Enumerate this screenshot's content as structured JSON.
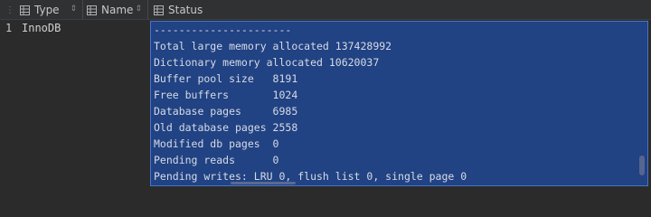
{
  "header": {
    "columns": [
      {
        "label": "Type"
      },
      {
        "label": "Name"
      },
      {
        "label": "Status"
      }
    ]
  },
  "row": {
    "number": "1",
    "type": "InnoDB",
    "status_lines": [
      "----------------------",
      "Total large memory allocated 137428992",
      "Dictionary memory allocated 10620037",
      "Buffer pool size   8191",
      "Free buffers       1024",
      "Database pages     6985",
      "Old database pages 2558",
      "Modified db pages  0",
      "Pending reads      0",
      "Pending writes: LRU 0, flush list 0, single page 0"
    ]
  },
  "colors": {
    "selection": "#214283",
    "selection_border": "#4a74c9",
    "background": "#2b2b2b"
  },
  "icons": {
    "column": "table-column-icon",
    "sort": "sort-arrows-icon"
  }
}
